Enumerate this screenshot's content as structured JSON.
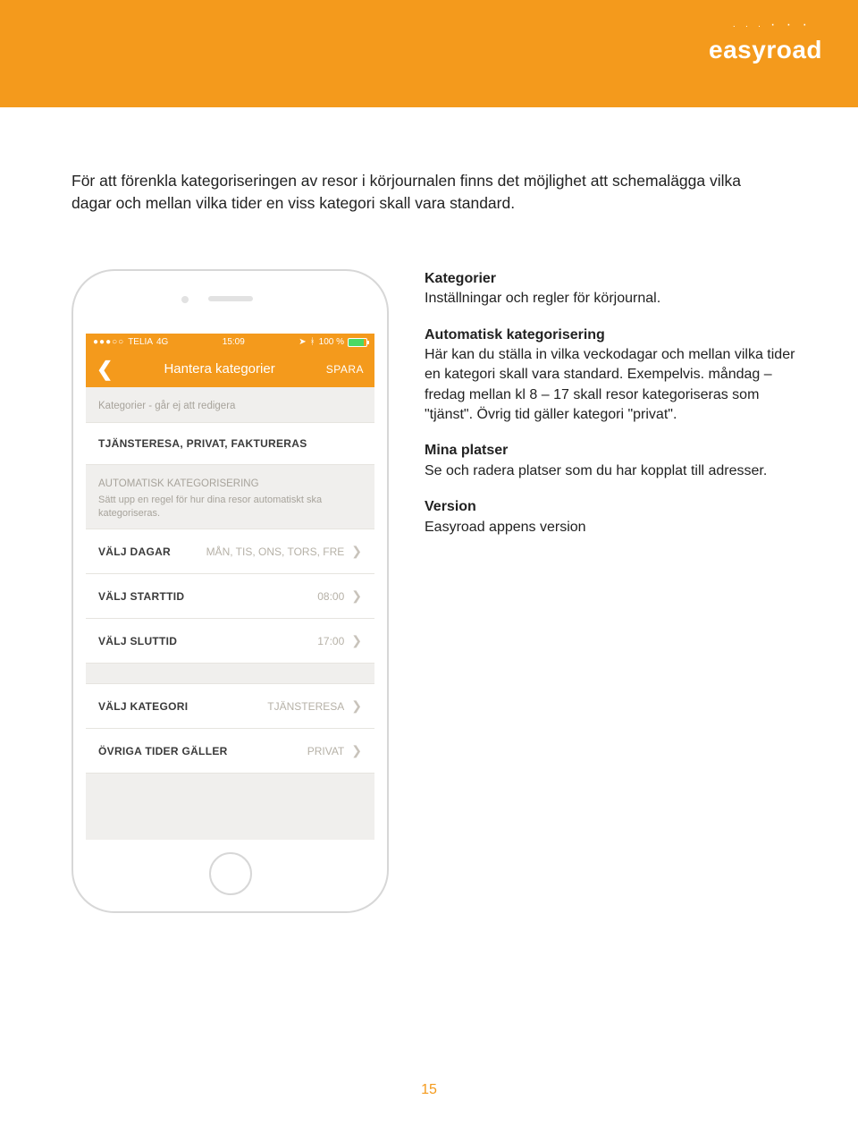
{
  "brand": {
    "name": "easyroad",
    "accent": "#f49a1c"
  },
  "intro": "För att förenkla kategoriseringen av resor i körjournalen finns det möjlighet att schemalägga vilka dagar och mellan vilka tider en viss kategori skall vara standard.",
  "phone": {
    "status": {
      "carrier": "TELIA",
      "network": "4G",
      "time": "15:09",
      "battery_pct": "100 %"
    },
    "nav": {
      "title": "Hantera kategorier",
      "save": "SPARA"
    },
    "section1_label": "Kategorier - går ej att redigera",
    "row_categories": "TJÄNSTERESA, PRIVAT, FAKTURERAS",
    "section2_title": "AUTOMATISK KATEGORISERING",
    "section2_sub": "Sätt upp en regel för hur dina resor automatiskt ska kategoriseras.",
    "rows": {
      "days_label": "VÄLJ DAGAR",
      "days_value": "MÅN, TIS, ONS, TORS, FRE",
      "start_label": "VÄLJ STARTTID",
      "start_value": "08:00",
      "end_label": "VÄLJ SLUTTID",
      "end_value": "17:00",
      "cat_label": "VÄLJ KATEGORI",
      "cat_value": "TJÄNSTERESA",
      "other_label": "ÖVRIGA TIDER GÄLLER",
      "other_value": "PRIVAT"
    }
  },
  "defs": {
    "b1_title": "Kategorier",
    "b1_body": "Inställningar och regler för körjournal.",
    "b2_title": "Automatisk kategorisering",
    "b2_body": "Här kan du ställa in vilka veckodagar och mellan vilka tider en kategori skall vara standard. Exempelvis. måndag – fredag mellan kl 8 – 17 skall resor kategoriseras som \"tjänst\". Övrig tid gäller kategori \"privat\".",
    "b3_title": "Mina platser",
    "b3_body": "Se och radera platser som du har kopplat till adresser.",
    "b4_title": "Version",
    "b4_body": "Easyroad appens version"
  },
  "page_number": "15"
}
